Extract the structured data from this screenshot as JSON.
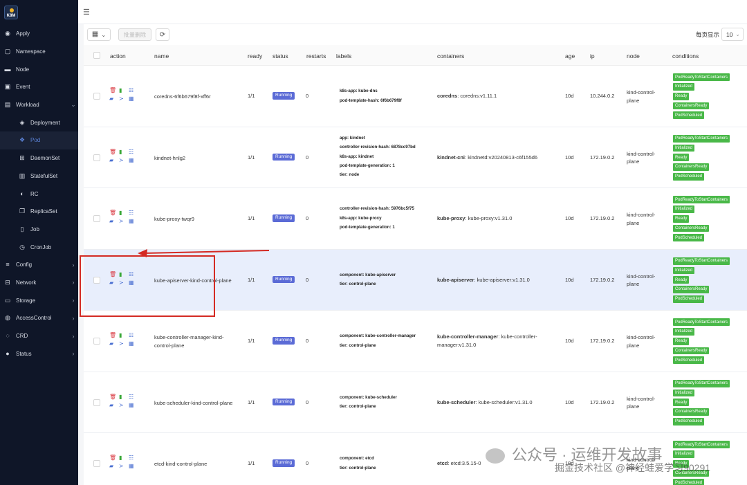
{
  "sidebar": {
    "logo": "K8M",
    "items": [
      {
        "label": "Apply",
        "icon": "globe-icon"
      },
      {
        "label": "Namespace",
        "icon": "square-icon"
      },
      {
        "label": "Node",
        "icon": "server-icon"
      },
      {
        "label": "Event",
        "icon": "event-icon"
      },
      {
        "label": "Workload",
        "icon": "briefcase-icon",
        "expanded": true
      },
      {
        "label": "Deployment",
        "icon": "layers-icon"
      },
      {
        "label": "Pod",
        "icon": "pod-icon",
        "active": true
      },
      {
        "label": "DaemonSet",
        "icon": "grid-icon"
      },
      {
        "label": "StatefulSet",
        "icon": "db-icon"
      },
      {
        "label": "RC",
        "icon": "rc-icon"
      },
      {
        "label": "ReplicaSet",
        "icon": "copy-icon"
      },
      {
        "label": "Job",
        "icon": "job-icon"
      },
      {
        "label": "CronJob",
        "icon": "clock-icon"
      },
      {
        "label": "Config",
        "icon": "sliders-icon"
      },
      {
        "label": "Network",
        "icon": "network-icon"
      },
      {
        "label": "Storage",
        "icon": "storage-icon"
      },
      {
        "label": "AccessControl",
        "icon": "shield-icon"
      },
      {
        "label": "CRD",
        "icon": "crd-icon"
      },
      {
        "label": "Status",
        "icon": "info-icon"
      }
    ]
  },
  "toolbar": {
    "batch_delete": "批量删除",
    "page_size_label": "每页显示",
    "page_size_value": "10"
  },
  "table": {
    "headers": {
      "action": "action",
      "name": "name",
      "ready": "ready",
      "status": "status",
      "restarts": "restarts",
      "labels": "labels",
      "containers": "containers",
      "age": "age",
      "ip": "ip",
      "node": "node",
      "conditions": "conditions"
    },
    "conditions": [
      "PodReadyToStartContainers",
      "Initialized",
      "Ready",
      "ContainersReady",
      "PodScheduled"
    ],
    "rows": [
      {
        "name": "coredns-6f6b679f8f-xff6r",
        "ready": "1/1",
        "status": "Running",
        "restarts": "0",
        "labels": [
          "k8s-app: kube-dns",
          "pod-template-hash: 6f6b679f8f"
        ],
        "container_name": "coredns",
        "container_image": "coredns:v1.11.1",
        "age": "10d",
        "ip": "10.244.0.2",
        "node_l1": "kind-control-",
        "node_l2": "plane"
      },
      {
        "name": "kindnet-hnlg2",
        "ready": "1/1",
        "status": "Running",
        "restarts": "0",
        "labels": [
          "app: kindnet",
          "controller-revision-hash: 6878cc97bd",
          "k8s-app: kindnet",
          "pod-template-generation: 1",
          "tier: node"
        ],
        "container_name": "kindnet-cni",
        "container_image": "kindnetd:v20240813-c6f155d6",
        "age": "10d",
        "ip": "172.19.0.2",
        "node_l1": "kind-control-",
        "node_l2": "plane"
      },
      {
        "name": "kube-proxy-twqr9",
        "ready": "1/1",
        "status": "Running",
        "restarts": "0",
        "labels": [
          "controller-revision-hash: 5976bc5f75",
          "k8s-app: kube-proxy",
          "pod-template-generation: 1"
        ],
        "container_name": "kube-proxy",
        "container_image": "kube-proxy:v1.31.0",
        "age": "10d",
        "ip": "172.19.0.2",
        "node_l1": "kind-control-",
        "node_l2": "plane"
      },
      {
        "name": "kube-apiserver-kind-control-plane",
        "ready": "1/1",
        "status": "Running",
        "restarts": "0",
        "labels": [
          "component: kube-apiserver",
          "tier: control-plane"
        ],
        "container_name": "kube-apiserver",
        "container_image": "kube-apiserver:v1.31.0",
        "age": "10d",
        "ip": "172.19.0.2",
        "node_l1": "kind-control-",
        "node_l2": "plane"
      },
      {
        "name_l1": "kube-controller-manager-kind-",
        "name_l2": "control-plane",
        "ready": "1/1",
        "status": "Running",
        "restarts": "0",
        "labels": [
          "component: kube-controller-manager",
          "tier: control-plane"
        ],
        "container_name": "kube-controller-manager",
        "container_image_l1": "kube-controller-",
        "container_image_l2": "manager:v1.31.0",
        "age": "10d",
        "ip": "172.19.0.2",
        "node_l1": "kind-control-",
        "node_l2": "plane"
      },
      {
        "name": "kube-scheduler-kind-control-plane",
        "ready": "1/1",
        "status": "Running",
        "restarts": "0",
        "labels": [
          "component: kube-scheduler",
          "tier: control-plane"
        ],
        "container_name": "kube-scheduler",
        "container_image": "kube-scheduler:v1.31.0",
        "age": "10d",
        "ip": "172.19.0.2",
        "node_l1": "kind-control-",
        "node_l2": "plane"
      },
      {
        "name": "etcd-kind-control-plane",
        "ready": "1/1",
        "status": "Running",
        "restarts": "0",
        "labels": [
          "component: etcd",
          "tier: control-plane"
        ],
        "container_name": "etcd",
        "container_image": "etcd:3.5.15-0",
        "age": "10d",
        "ip": "",
        "node_l1": "kind-control-",
        "node_l2": "plane"
      }
    ]
  },
  "watermarks": {
    "line1": "公众号 · 运维开发故事",
    "line2": "掘金技术社区 @神经蛙爱学习90291"
  },
  "colors": {
    "sidebar_bg": "#0f1628",
    "running": "#5b6bd6",
    "condition": "#49b848",
    "highlight_row": "#e8eefc",
    "annotation": "#d42a23"
  }
}
